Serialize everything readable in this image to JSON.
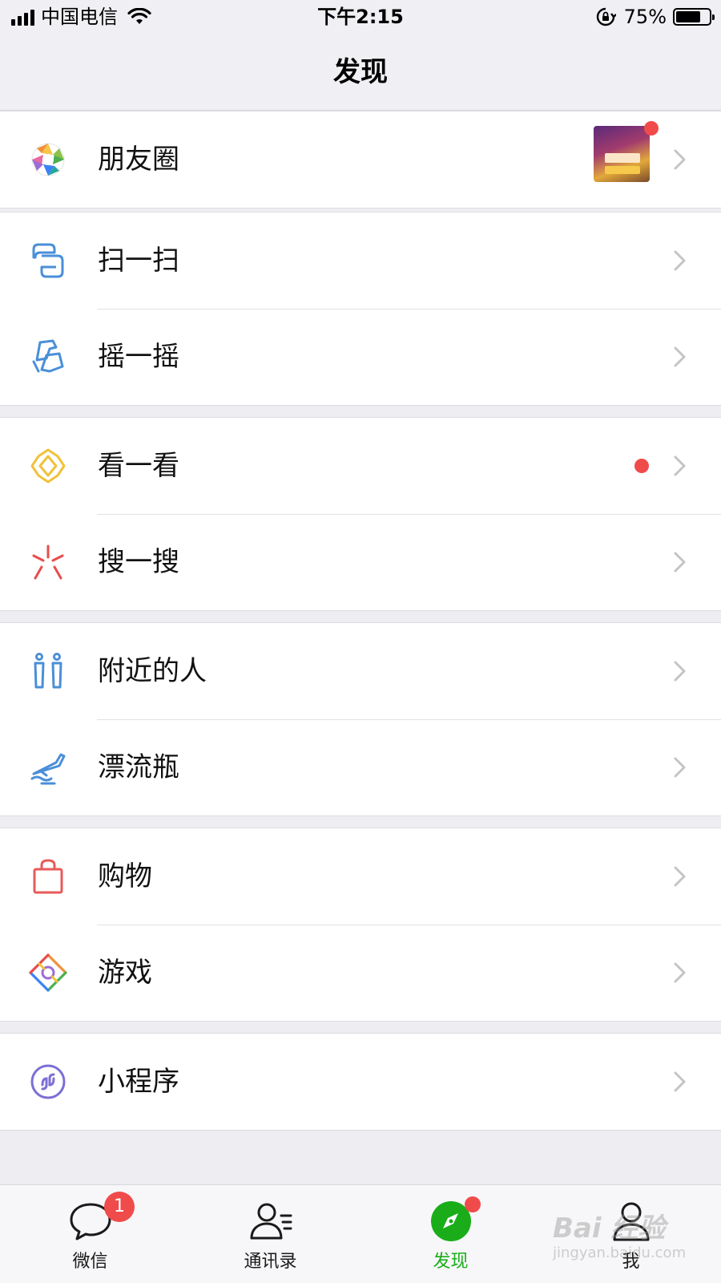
{
  "status_bar": {
    "carrier": "中国电信",
    "time": "下午2:15",
    "battery_percent": "75%",
    "battery_level": 0.75
  },
  "nav": {
    "title": "发现"
  },
  "menu": {
    "groups": [
      {
        "items": [
          {
            "label": "朋友圈",
            "icon": "moments-icon",
            "has_thumbnail": true,
            "has_badge_dot": true
          }
        ]
      },
      {
        "items": [
          {
            "label": "扫一扫",
            "icon": "scan-icon"
          },
          {
            "label": "摇一摇",
            "icon": "shake-icon"
          }
        ]
      },
      {
        "items": [
          {
            "label": "看一看",
            "icon": "top-stories-icon",
            "has_red_dot": true
          },
          {
            "label": "搜一搜",
            "icon": "search-icon"
          }
        ]
      },
      {
        "items": [
          {
            "label": "附近的人",
            "icon": "people-nearby-icon"
          },
          {
            "label": "漂流瓶",
            "icon": "drift-bottle-icon"
          }
        ]
      },
      {
        "items": [
          {
            "label": "购物",
            "icon": "shopping-bag-icon"
          },
          {
            "label": "游戏",
            "icon": "games-icon"
          }
        ]
      },
      {
        "items": [
          {
            "label": "小程序",
            "icon": "mini-programs-icon"
          }
        ]
      }
    ]
  },
  "tab_bar": {
    "tabs": [
      {
        "label": "微信",
        "icon": "chat-bubble-icon",
        "badge": "1"
      },
      {
        "label": "通讯录",
        "icon": "contacts-icon"
      },
      {
        "label": "发现",
        "icon": "compass-icon",
        "active": true,
        "dot": true
      },
      {
        "label": "我",
        "icon": "me-icon"
      }
    ]
  },
  "colors": {
    "accent_green": "#1aad19",
    "badge_red": "#f04b4b",
    "background": "#eeeef2"
  },
  "watermark": {
    "main": "Bai 经验",
    "sub": "jingyan.baidu.com"
  }
}
